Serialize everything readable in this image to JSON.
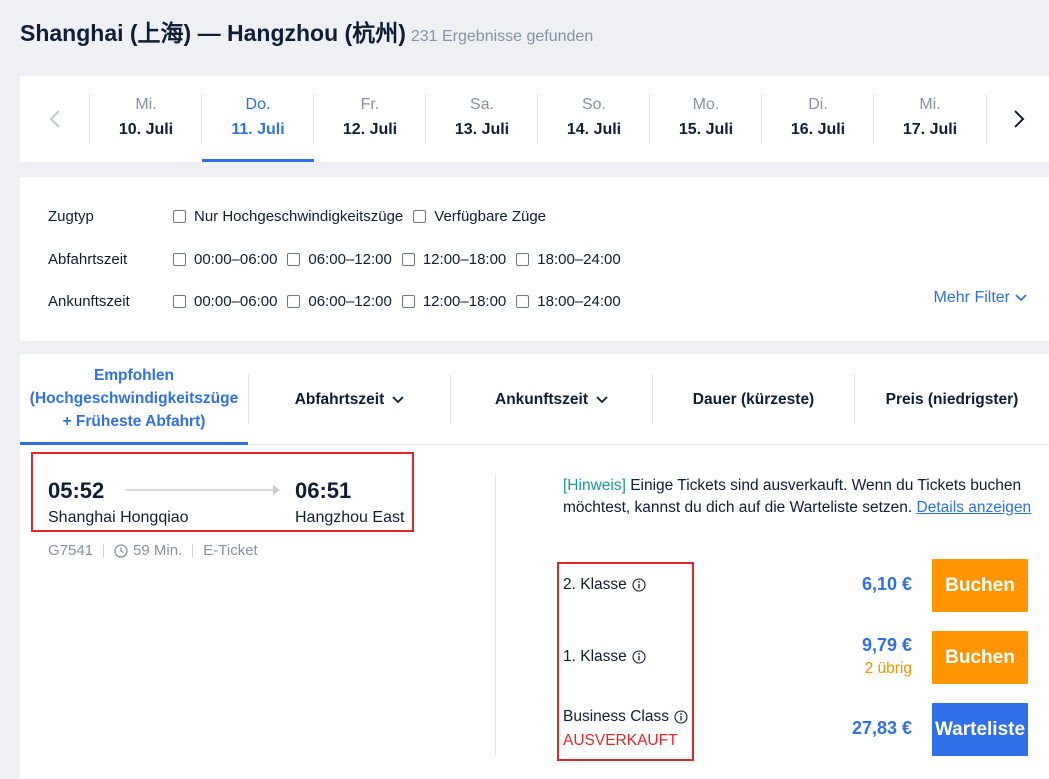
{
  "header": {
    "title": "Shanghai (上海) — Hangzhou (杭州)",
    "results_count": "231 Ergebnisse gefunden"
  },
  "date_bar": {
    "prev_icon": "chevron-left-icon",
    "next_icon": "chevron-right-icon",
    "dates": [
      {
        "dow": "Mi.",
        "day": "10. Juli",
        "active": false
      },
      {
        "dow": "Do.",
        "day": "11. Juli",
        "active": true
      },
      {
        "dow": "Fr.",
        "day": "12. Juli",
        "active": false
      },
      {
        "dow": "Sa.",
        "day": "13. Juli",
        "active": false
      },
      {
        "dow": "So.",
        "day": "14. Juli",
        "active": false
      },
      {
        "dow": "Mo.",
        "day": "15. Juli",
        "active": false
      },
      {
        "dow": "Di.",
        "day": "16. Juli",
        "active": false
      },
      {
        "dow": "Mi.",
        "day": "17. Juli",
        "active": false
      }
    ]
  },
  "filters": {
    "train_type": {
      "label": "Zugtyp",
      "options": [
        "Nur Hochgeschwindigkeitszüge",
        "Verfügbare Züge"
      ]
    },
    "departure": {
      "label": "Abfahrtszeit",
      "options": [
        "00:00–06:00",
        "06:00–12:00",
        "12:00–18:00",
        "18:00–24:00"
      ]
    },
    "arrival": {
      "label": "Ankunftszeit",
      "options": [
        "00:00–06:00",
        "06:00–12:00",
        "12:00–18:00",
        "18:00–24:00"
      ]
    },
    "more": "Mehr Filter"
  },
  "sort": {
    "recommended_line1": "Empfohlen",
    "recommended_line2": "(Hochgeschwindigkeitszüge",
    "recommended_line3": "+ Früheste Abfahrt)",
    "departure": "Abfahrtszeit",
    "arrival": "Ankunftszeit",
    "duration": "Dauer (kürzeste)",
    "price": "Preis (niedrigster)"
  },
  "train": {
    "depart_time": "05:52",
    "depart_station": "Shanghai Hongqiao",
    "arrive_time": "06:51",
    "arrive_station": "Hangzhou East",
    "number": "G7541",
    "duration": "59 Min.",
    "ticket_type": "E-Ticket",
    "notice_tag": "[Hinweis]",
    "notice_text": " Einige Tickets sind ausverkauft. Wenn du Tickets buchen möchtest, kannst du dich auf die Warteliste setzen. ",
    "notice_link": "Details anzeigen",
    "classes": [
      {
        "name": "2. Klasse",
        "price": "6,10 €",
        "button": "Buchen"
      },
      {
        "name": "1. Klasse",
        "price": "9,79 €",
        "remaining": "2 übrig",
        "button": "Buchen"
      },
      {
        "name": "Business Class",
        "price": "27,83 €",
        "status": "AUSVERKAUFT",
        "button": "Warteliste"
      }
    ]
  },
  "colors": {
    "accent": "#2f6fe8",
    "orange": "#ff9500",
    "sold_out": "#e0282a",
    "notice_tag": "#1a9a9a"
  }
}
